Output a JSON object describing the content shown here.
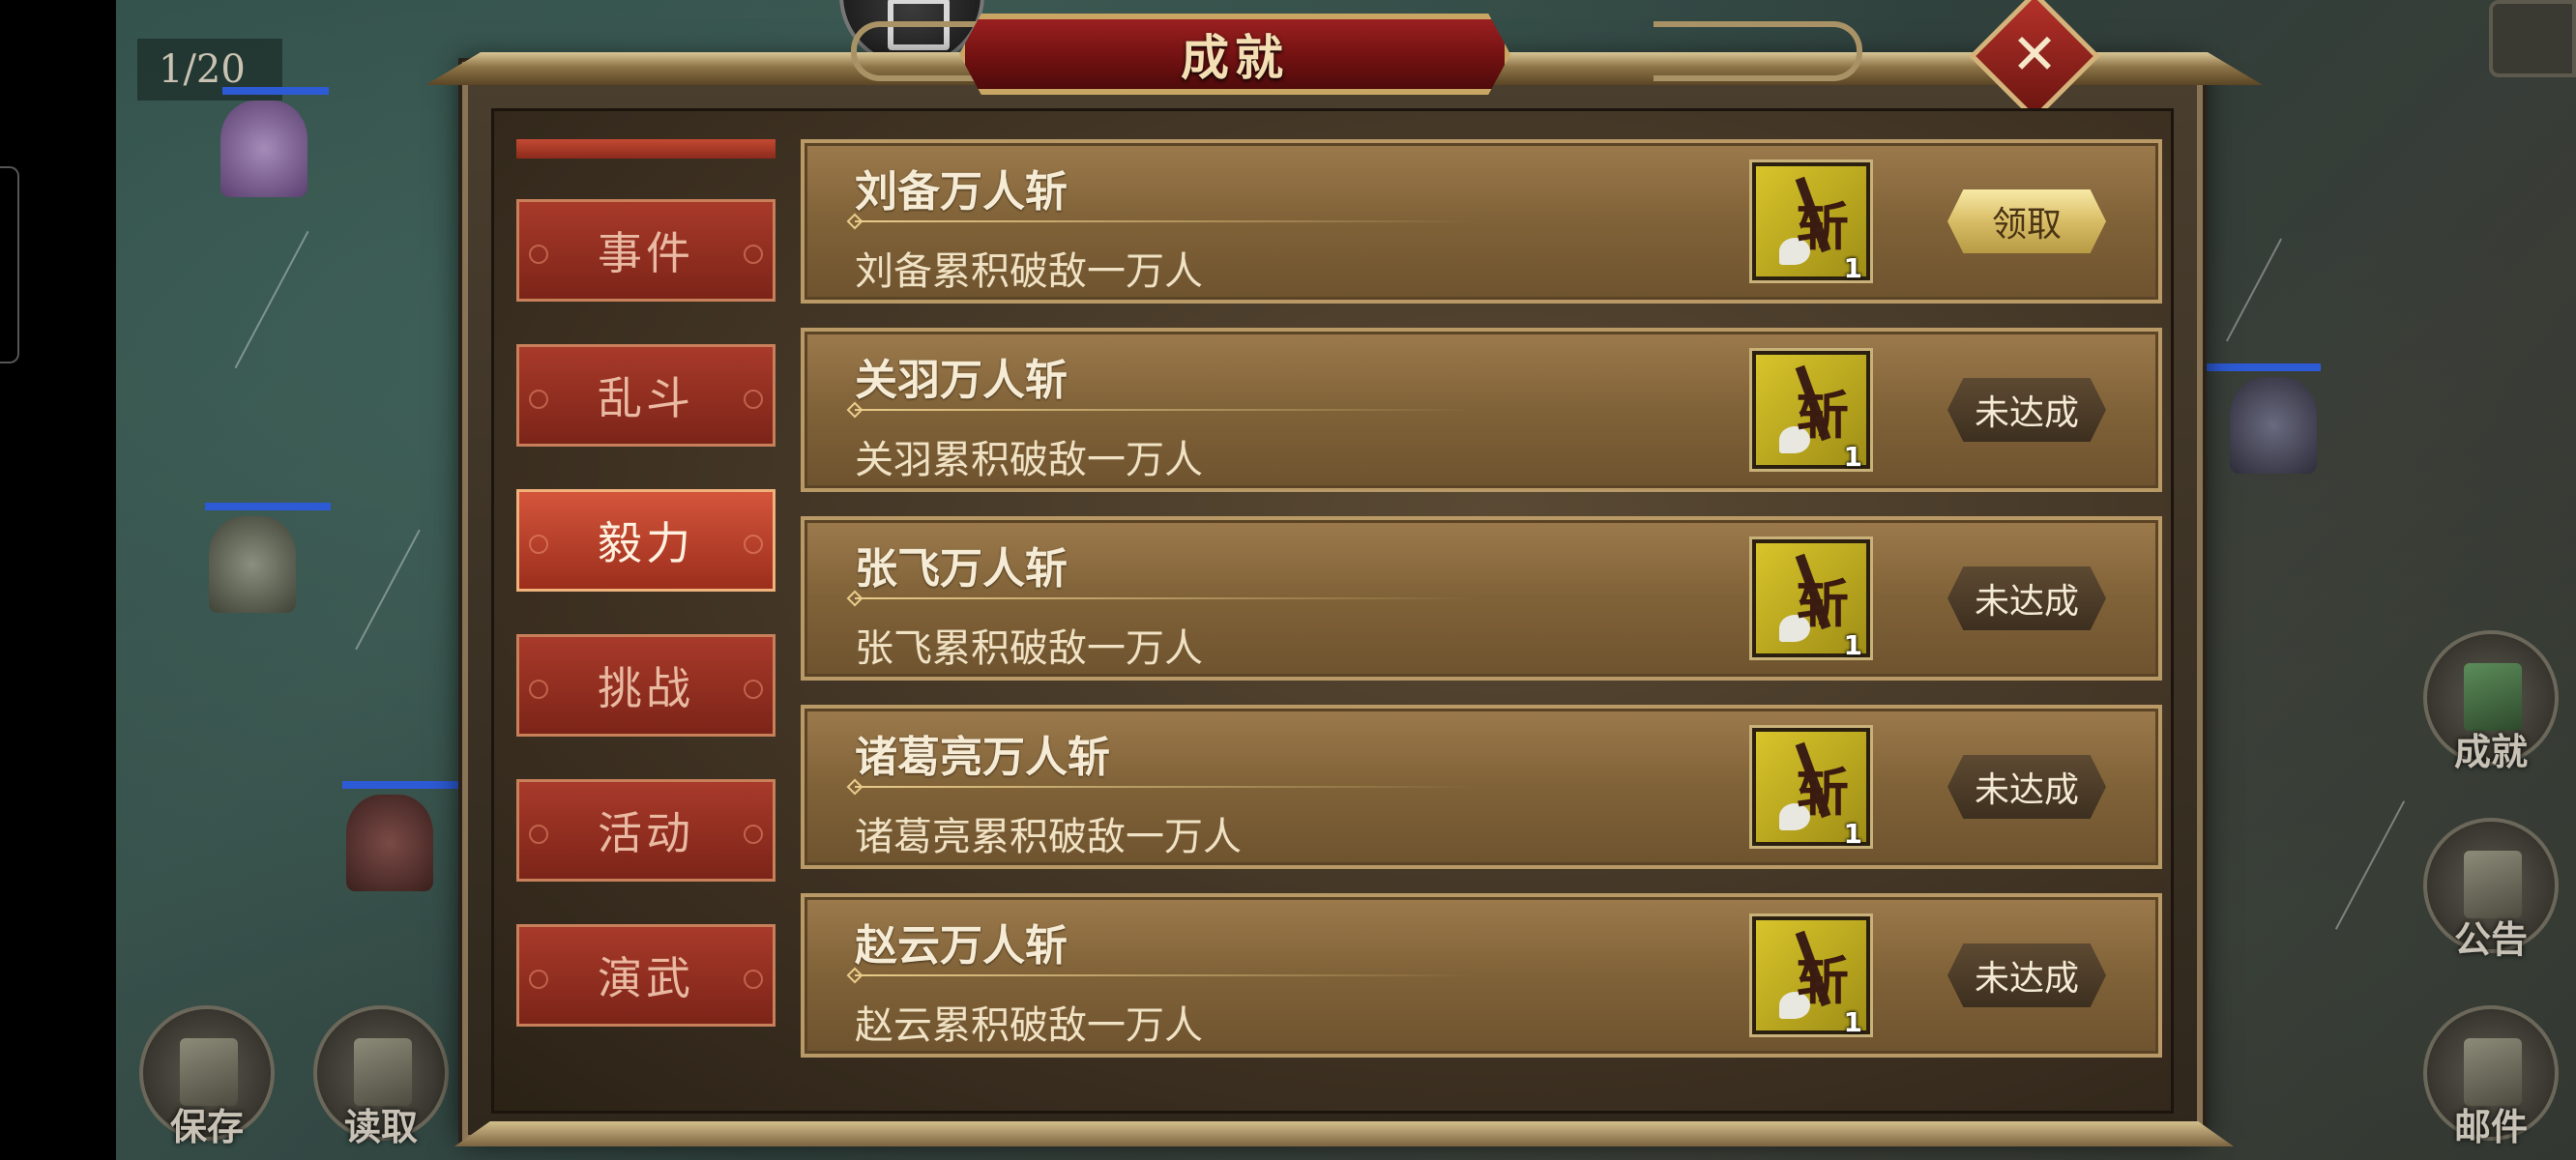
{
  "hud": {
    "counter": "1/20",
    "buttons": {
      "save": "保存",
      "load": "读取",
      "achievement": "成就",
      "notice": "公告",
      "mail": "邮件"
    }
  },
  "dialog": {
    "title": "成就",
    "tabs": [
      {
        "label": "事件",
        "active": false
      },
      {
        "label": "乱斗",
        "active": false
      },
      {
        "label": "毅力",
        "active": true
      },
      {
        "label": "挑战",
        "active": false
      },
      {
        "label": "活动",
        "active": false
      },
      {
        "label": "演武",
        "active": false
      }
    ],
    "achievements": [
      {
        "name": "刘备万人斩",
        "desc": "刘备累积破敌一万人",
        "reward_qty": "1",
        "reward_glyph": "斩",
        "status": "领取",
        "claimable": true
      },
      {
        "name": "关羽万人斩",
        "desc": "关羽累积破敌一万人",
        "reward_qty": "1",
        "reward_glyph": "斩",
        "status": "未达成",
        "claimable": false
      },
      {
        "name": "张飞万人斩",
        "desc": "张飞累积破敌一万人",
        "reward_qty": "1",
        "reward_glyph": "斩",
        "status": "未达成",
        "claimable": false
      },
      {
        "name": "诸葛亮万人斩",
        "desc": "诸葛亮累积破敌一万人",
        "reward_qty": "1",
        "reward_glyph": "斩",
        "status": "未达成",
        "claimable": false
      },
      {
        "name": "赵云万人斩",
        "desc": "赵云累积破敌一万人",
        "reward_qty": "1",
        "reward_glyph": "斩",
        "status": "未达成",
        "claimable": false
      }
    ]
  },
  "colors": {
    "panel_gold": "#b99a66",
    "tab_red": "#a83a2a",
    "title_red": "#9b2020",
    "claim_gold": "#d9bd66"
  }
}
